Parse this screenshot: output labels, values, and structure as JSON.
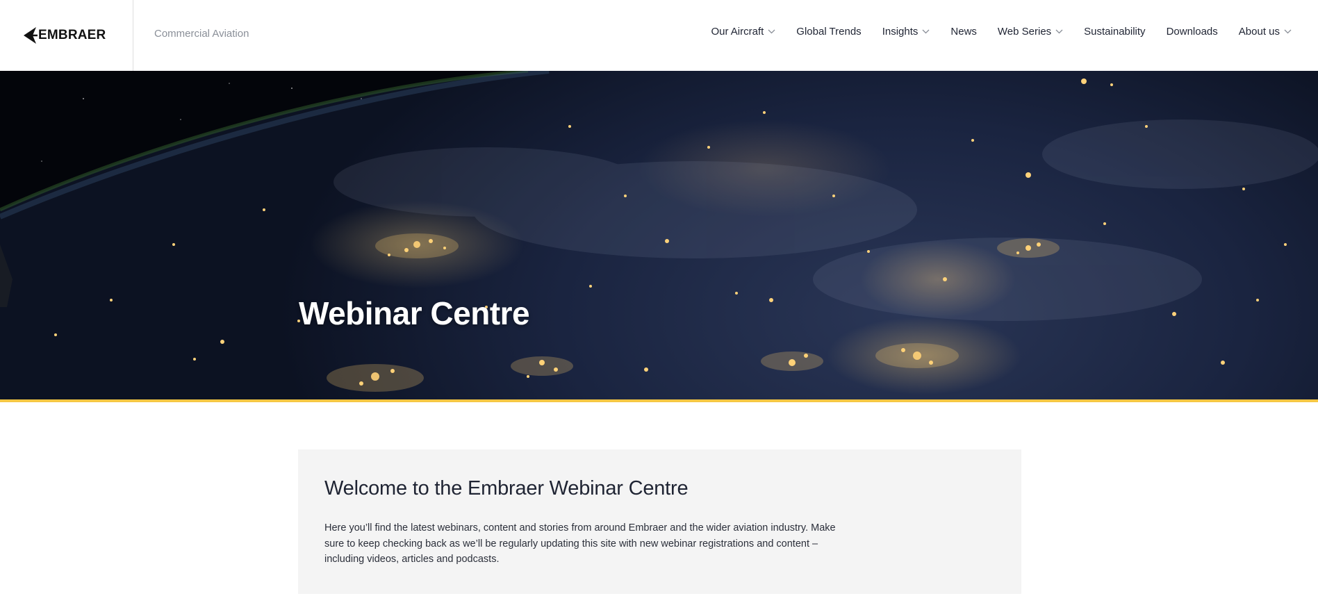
{
  "header": {
    "logo_text": "EMBRAER",
    "tagline": "Commercial Aviation"
  },
  "nav": [
    {
      "label": "Our Aircraft",
      "has_dropdown": true
    },
    {
      "label": "Global Trends",
      "has_dropdown": false
    },
    {
      "label": "Insights",
      "has_dropdown": true
    },
    {
      "label": "News",
      "has_dropdown": false
    },
    {
      "label": "Web Series",
      "has_dropdown": true
    },
    {
      "label": "Sustainability",
      "has_dropdown": false
    },
    {
      "label": "Downloads",
      "has_dropdown": false
    },
    {
      "label": "About us",
      "has_dropdown": true
    }
  ],
  "hero": {
    "title": "Webinar Centre",
    "accent_color": "#f5c744"
  },
  "welcome": {
    "title": "Welcome to the Embraer Webinar Centre",
    "body": "Here you’ll find the latest webinars, content and stories from around Embraer and the wider aviation industry. Make sure to keep checking back as we’ll be regularly updating this site with new webinar registrations and content – including videos, articles and podcasts."
  },
  "icons": {
    "logo": "embraer-logo-icon",
    "dropdown": "chevron-down-icon"
  }
}
